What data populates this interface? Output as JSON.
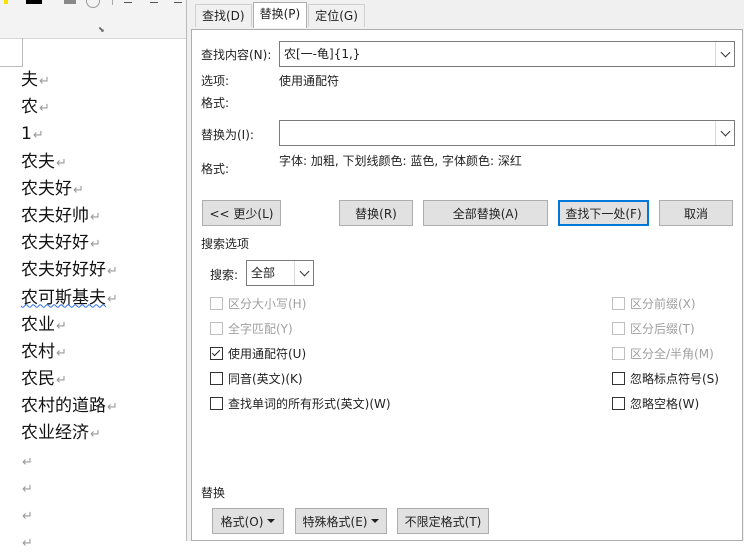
{
  "document": {
    "lines": [
      {
        "text": "夫",
        "mark": "↵"
      },
      {
        "text": "农",
        "mark": "↵"
      },
      {
        "text": "1",
        "mark": "↵"
      },
      {
        "text": "农夫",
        "mark": "↵"
      },
      {
        "text": "农夫好",
        "mark": "↵"
      },
      {
        "text": "农夫好帅",
        "mark": "↵"
      },
      {
        "text": "农夫好好",
        "mark": "↵"
      },
      {
        "text": "农夫好好好",
        "mark": "↵"
      },
      {
        "text": "农可斯基夫",
        "mark": "↵"
      },
      {
        "text": "农业",
        "mark": "↵"
      },
      {
        "text": "农村",
        "mark": "↵"
      },
      {
        "text": "农民",
        "mark": "↵"
      },
      {
        "text": "农村的道路",
        "mark": "↵"
      },
      {
        "text": "农业经济",
        "mark": "↵"
      },
      {
        "text": "",
        "mark": "↵"
      },
      {
        "text": "",
        "mark": "↵"
      },
      {
        "text": "",
        "mark": "↵"
      },
      {
        "text": "",
        "mark": "↵"
      }
    ]
  },
  "dialog": {
    "tabs": [
      {
        "label": "查找(D)"
      },
      {
        "label": "替换(P)"
      },
      {
        "label": "定位(G)"
      }
    ],
    "find": {
      "label": "查找内容(N):",
      "value": "农[一-龟]{1,}"
    },
    "options_label": "选项:",
    "options_value": "使用通配符",
    "format_label_1": "格式:",
    "replace": {
      "label": "替换为(I):",
      "value": ""
    },
    "format_label_2": "格式:",
    "format_value_2": "字体: 加粗, 下划线颜色: 蓝色, 字体颜色: 深红",
    "buttons": {
      "less": "<< 更少(L)",
      "replace": "替换(R)",
      "replace_all": "全部替换(A)",
      "find_next": "查找下一处(F)",
      "cancel": "取消"
    },
    "search_options_title": "搜索选项",
    "search_label": "搜索:",
    "search_value": "全部",
    "checkboxes_left": [
      {
        "label": "区分大小写(H)",
        "checked": false,
        "disabled": true
      },
      {
        "label": "全字匹配(Y)",
        "checked": false,
        "disabled": true
      },
      {
        "label": "使用通配符(U)",
        "checked": true,
        "disabled": false
      },
      {
        "label": "同音(英文)(K)",
        "checked": false,
        "disabled": false
      },
      {
        "label": "查找单词的所有形式(英文)(W)",
        "checked": false,
        "disabled": false
      }
    ],
    "checkboxes_right": [
      {
        "label": "区分前缀(X)",
        "checked": false,
        "disabled": true
      },
      {
        "label": "区分后缀(T)",
        "checked": false,
        "disabled": true
      },
      {
        "label": "区分全/半角(M)",
        "checked": false,
        "disabled": true
      },
      {
        "label": "忽略标点符号(S)",
        "checked": false,
        "disabled": false
      },
      {
        "label": "忽略空格(W)",
        "checked": false,
        "disabled": false
      }
    ],
    "replace_section_title": "替换",
    "bottom_buttons": {
      "format": "格式(O)",
      "special": "特殊格式(E)",
      "no_format": "不限定格式(T)"
    }
  }
}
